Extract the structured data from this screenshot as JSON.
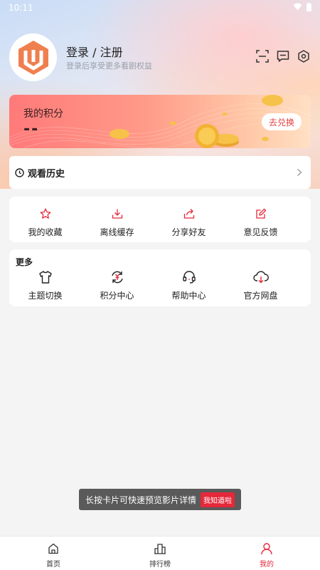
{
  "status_bar": {
    "time": "10:11"
  },
  "profile": {
    "title": "登录 / 注册",
    "subtitle": "登录后享受更多看剧权益"
  },
  "top_icons": [
    "scan-icon",
    "message-icon",
    "settings-icon"
  ],
  "points": {
    "label": "我的积分",
    "value": "--",
    "exchange_label": "去兑换"
  },
  "history": {
    "label": "观看历史"
  },
  "actions": {
    "items": [
      {
        "label": "我的收藏",
        "icon": "star-icon"
      },
      {
        "label": "离线缓存",
        "icon": "download-icon"
      },
      {
        "label": "分享好友",
        "icon": "share-icon"
      },
      {
        "label": "意见反馈",
        "icon": "feedback-icon"
      }
    ]
  },
  "more": {
    "title": "更多",
    "items": [
      {
        "label": "主题切换",
        "icon": "tshirt-icon"
      },
      {
        "label": "积分中心",
        "icon": "points-center-icon"
      },
      {
        "label": "帮助中心",
        "icon": "headset-icon"
      },
      {
        "label": "官方网盘",
        "icon": "cloud-download-icon"
      }
    ]
  },
  "toast": {
    "message": "长按卡片可快速预览影片详情",
    "button": "我知道啦"
  },
  "bottom_nav": {
    "items": [
      {
        "label": "首页",
        "icon": "home-icon"
      },
      {
        "label": "排行榜",
        "icon": "ranking-icon"
      },
      {
        "label": "我的",
        "icon": "user-icon"
      }
    ],
    "active": "我的"
  },
  "colors": {
    "accent": "#e5283a",
    "brand": "#ef7f4f"
  }
}
